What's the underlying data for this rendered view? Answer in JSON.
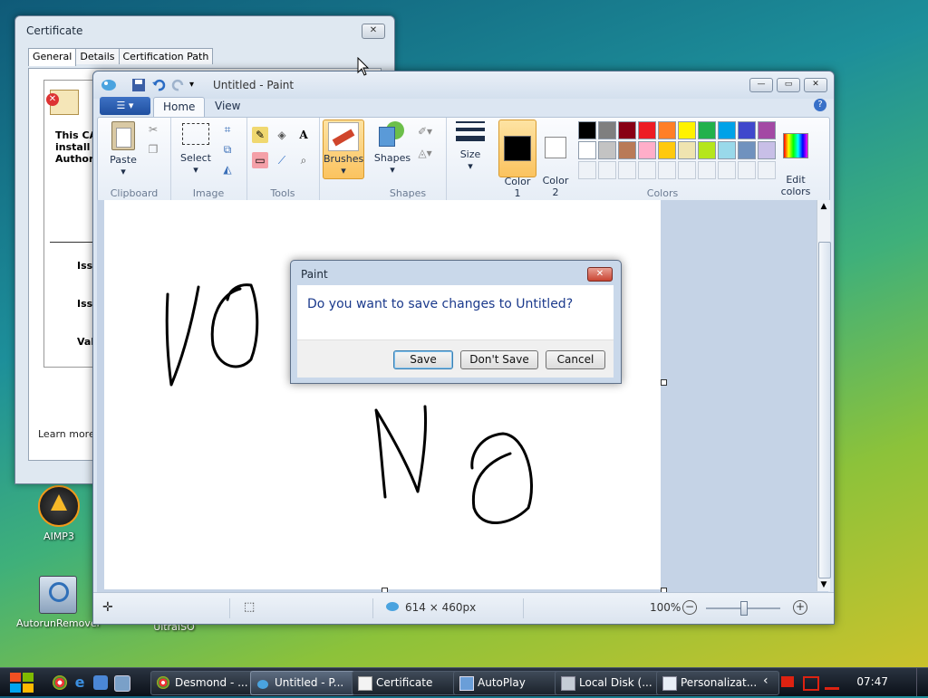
{
  "desktop": {
    "icons": [
      {
        "label": "AIMP3"
      },
      {
        "label": "AutorunRemover"
      },
      {
        "label": "UltraISO"
      }
    ]
  },
  "certificate_window": {
    "title": "Certificate",
    "close": "✕",
    "tabs": [
      "General",
      "Details",
      "Certification Path"
    ],
    "desc_lines": [
      "This CA",
      "install t",
      "Authori"
    ],
    "fields": [
      "Iss",
      "Iss",
      "Val"
    ],
    "learn_more": "Learn more a"
  },
  "paint": {
    "title": "Untitled - Paint",
    "tabs": {
      "home": "Home",
      "view": "View"
    },
    "ribbon": {
      "clipboard": {
        "label": "Clipboard",
        "paste": "Paste"
      },
      "image": {
        "label": "Image",
        "select": "Select"
      },
      "tools": {
        "label": "Tools"
      },
      "brushes": "Brushes",
      "shapes": {
        "label": "Shapes",
        "button": "Shapes"
      },
      "size": "Size",
      "color1": "Color\n1",
      "color2": "Color\n2",
      "colors_label": "Colors",
      "edit_colors": "Edit\ncolors",
      "palette_row1": [
        "#000000",
        "#7f7f7f",
        "#880015",
        "#ed1c24",
        "#ff7f27",
        "#fff200",
        "#22b14c",
        "#00a2e8",
        "#3f48cc",
        "#a349a4"
      ],
      "palette_row2": [
        "#ffffff",
        "#c3c3c3",
        "#b97a57",
        "#ffaec9",
        "#ffc90e",
        "#efe4b0",
        "#b5e61d",
        "#99d9ea",
        "#7092be",
        "#c8bfe7"
      ]
    },
    "status": {
      "dimensions": "614 × 460px",
      "zoom": "100%"
    }
  },
  "dialog": {
    "title": "Paint",
    "message": "Do you want to save changes to Untitled?",
    "save": "Save",
    "dont_save": "Don't Save",
    "cancel": "Cancel"
  },
  "taskbar": {
    "buttons": [
      {
        "label": "Desmond - ..."
      },
      {
        "label": "Untitled - P..."
      },
      {
        "label": "Certificate"
      },
      {
        "label": "AutoPlay"
      },
      {
        "label": "Local Disk (..."
      },
      {
        "label": "Personalizat..."
      }
    ],
    "clock": "07:47",
    "tray_arrow": "‹"
  }
}
